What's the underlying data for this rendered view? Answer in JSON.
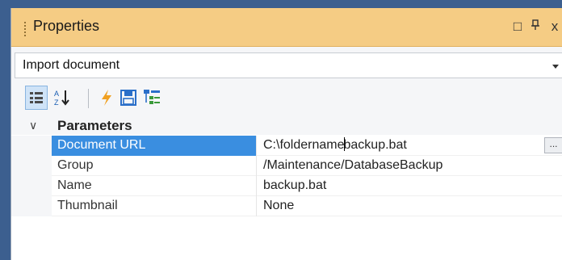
{
  "panel": {
    "title": "Properties",
    "title_buttons": [
      "□",
      "ᵖ",
      "x"
    ]
  },
  "object_selector": {
    "value": "Import document"
  },
  "toolbar": {
    "buttons": [
      {
        "name": "categorized-icon",
        "active": true
      },
      {
        "name": "alphabetical-sort-icon",
        "active": false
      },
      {
        "name": "events-lightning-icon",
        "active": false
      },
      {
        "name": "save-icon",
        "active": false
      },
      {
        "name": "hierarchy-icon",
        "active": false
      }
    ]
  },
  "grid": {
    "category": "Parameters",
    "rows": [
      {
        "name": "Document URL",
        "value_before": "C:\\foldername",
        "value_after": "backup.bat",
        "selected": true,
        "ellipsis": "..."
      },
      {
        "name": "Group",
        "value": "/Maintenance/DatabaseBackup"
      },
      {
        "name": "Name",
        "value": "backup.bat"
      },
      {
        "name": "Thumbnail",
        "value": "None"
      }
    ]
  },
  "colors": {
    "titlebar": "#f5cc84",
    "selection": "#3a8ee0",
    "frame": "#3c5f8f"
  }
}
